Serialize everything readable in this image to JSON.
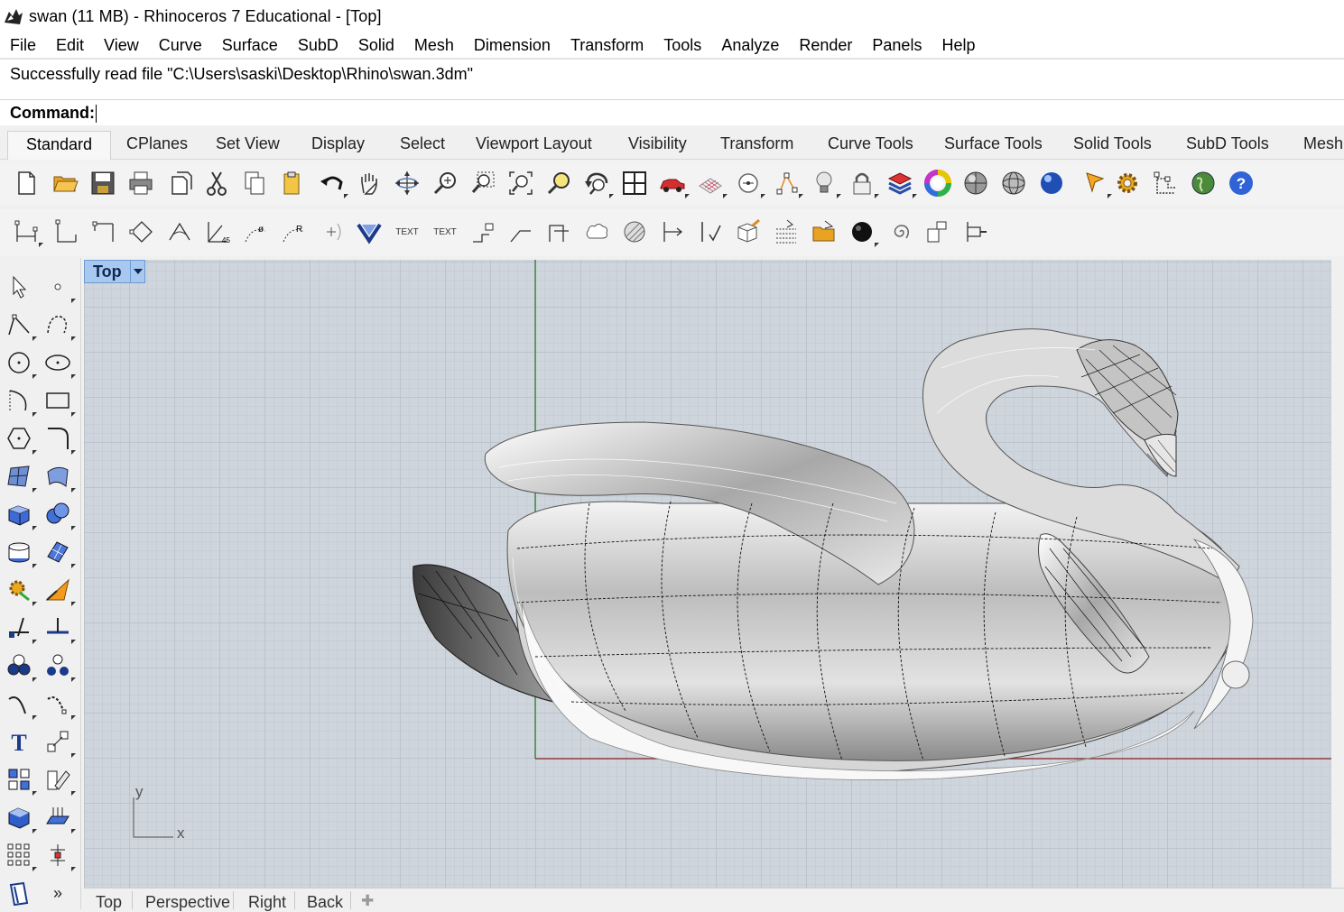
{
  "window": {
    "title": "swan (11 MB) - Rhinoceros 7 Educational - [Top]",
    "app_icon": "rhino-logo-icon"
  },
  "menu": [
    "File",
    "Edit",
    "View",
    "Curve",
    "Surface",
    "SubD",
    "Solid",
    "Mesh",
    "Dimension",
    "Transform",
    "Tools",
    "Analyze",
    "Render",
    "Panels",
    "Help"
  ],
  "command_history": {
    "line": "Successfully read file \"C:\\Users\\saski\\Desktop\\Rhino\\swan.3dm\""
  },
  "command": {
    "prompt": "Command:",
    "value": ""
  },
  "toolbar_tabs": [
    "Standard",
    "CPlanes",
    "Set View",
    "Display",
    "Select",
    "Viewport Layout",
    "Visibility",
    "Transform",
    "Curve Tools",
    "Surface Tools",
    "Solid Tools",
    "SubD Tools",
    "Mesh"
  ],
  "active_tab": "Standard",
  "toolbar_row1_icons": [
    "new-file-icon",
    "open-folder-icon",
    "save-icon",
    "print-icon",
    "import-icon",
    "cut-icon",
    "copy-icon",
    "paste-icon",
    "undo-icon",
    "pan-hand-icon",
    "rotate-view-icon",
    "zoom-icon",
    "zoom-window-icon",
    "zoom-extents-icon",
    "zoom-selected-icon",
    "rotate-camera-icon",
    "viewport-layout-icon",
    "car-icon",
    "grid-icon",
    "osnap-icon",
    "points-icon",
    "light-bulb-icon",
    "lock-icon",
    "layer-icon",
    "color-wheel-icon",
    "shaded-sphere-icon",
    "wireframe-sphere-icon",
    "render-sphere-icon",
    "pointer-icon",
    "gear-icon",
    "structure-icon",
    "globe-icon",
    "help-icon"
  ],
  "toolbar_row2": {
    "text_button_1": "TEXT",
    "text_button_2": "TEXT"
  },
  "viewport": {
    "name": "Top",
    "axis_x": "x",
    "axis_y": "y"
  },
  "viewport_tabs": [
    "Top",
    "Perspective",
    "Right",
    "Back"
  ],
  "sidebar_overflow": "»",
  "colors": {
    "x_axis": "#8b2323",
    "y_axis": "#2f7d2f",
    "viewport_label_bg": "#a8c8ef",
    "grid_bg": "#cfd5dc"
  }
}
